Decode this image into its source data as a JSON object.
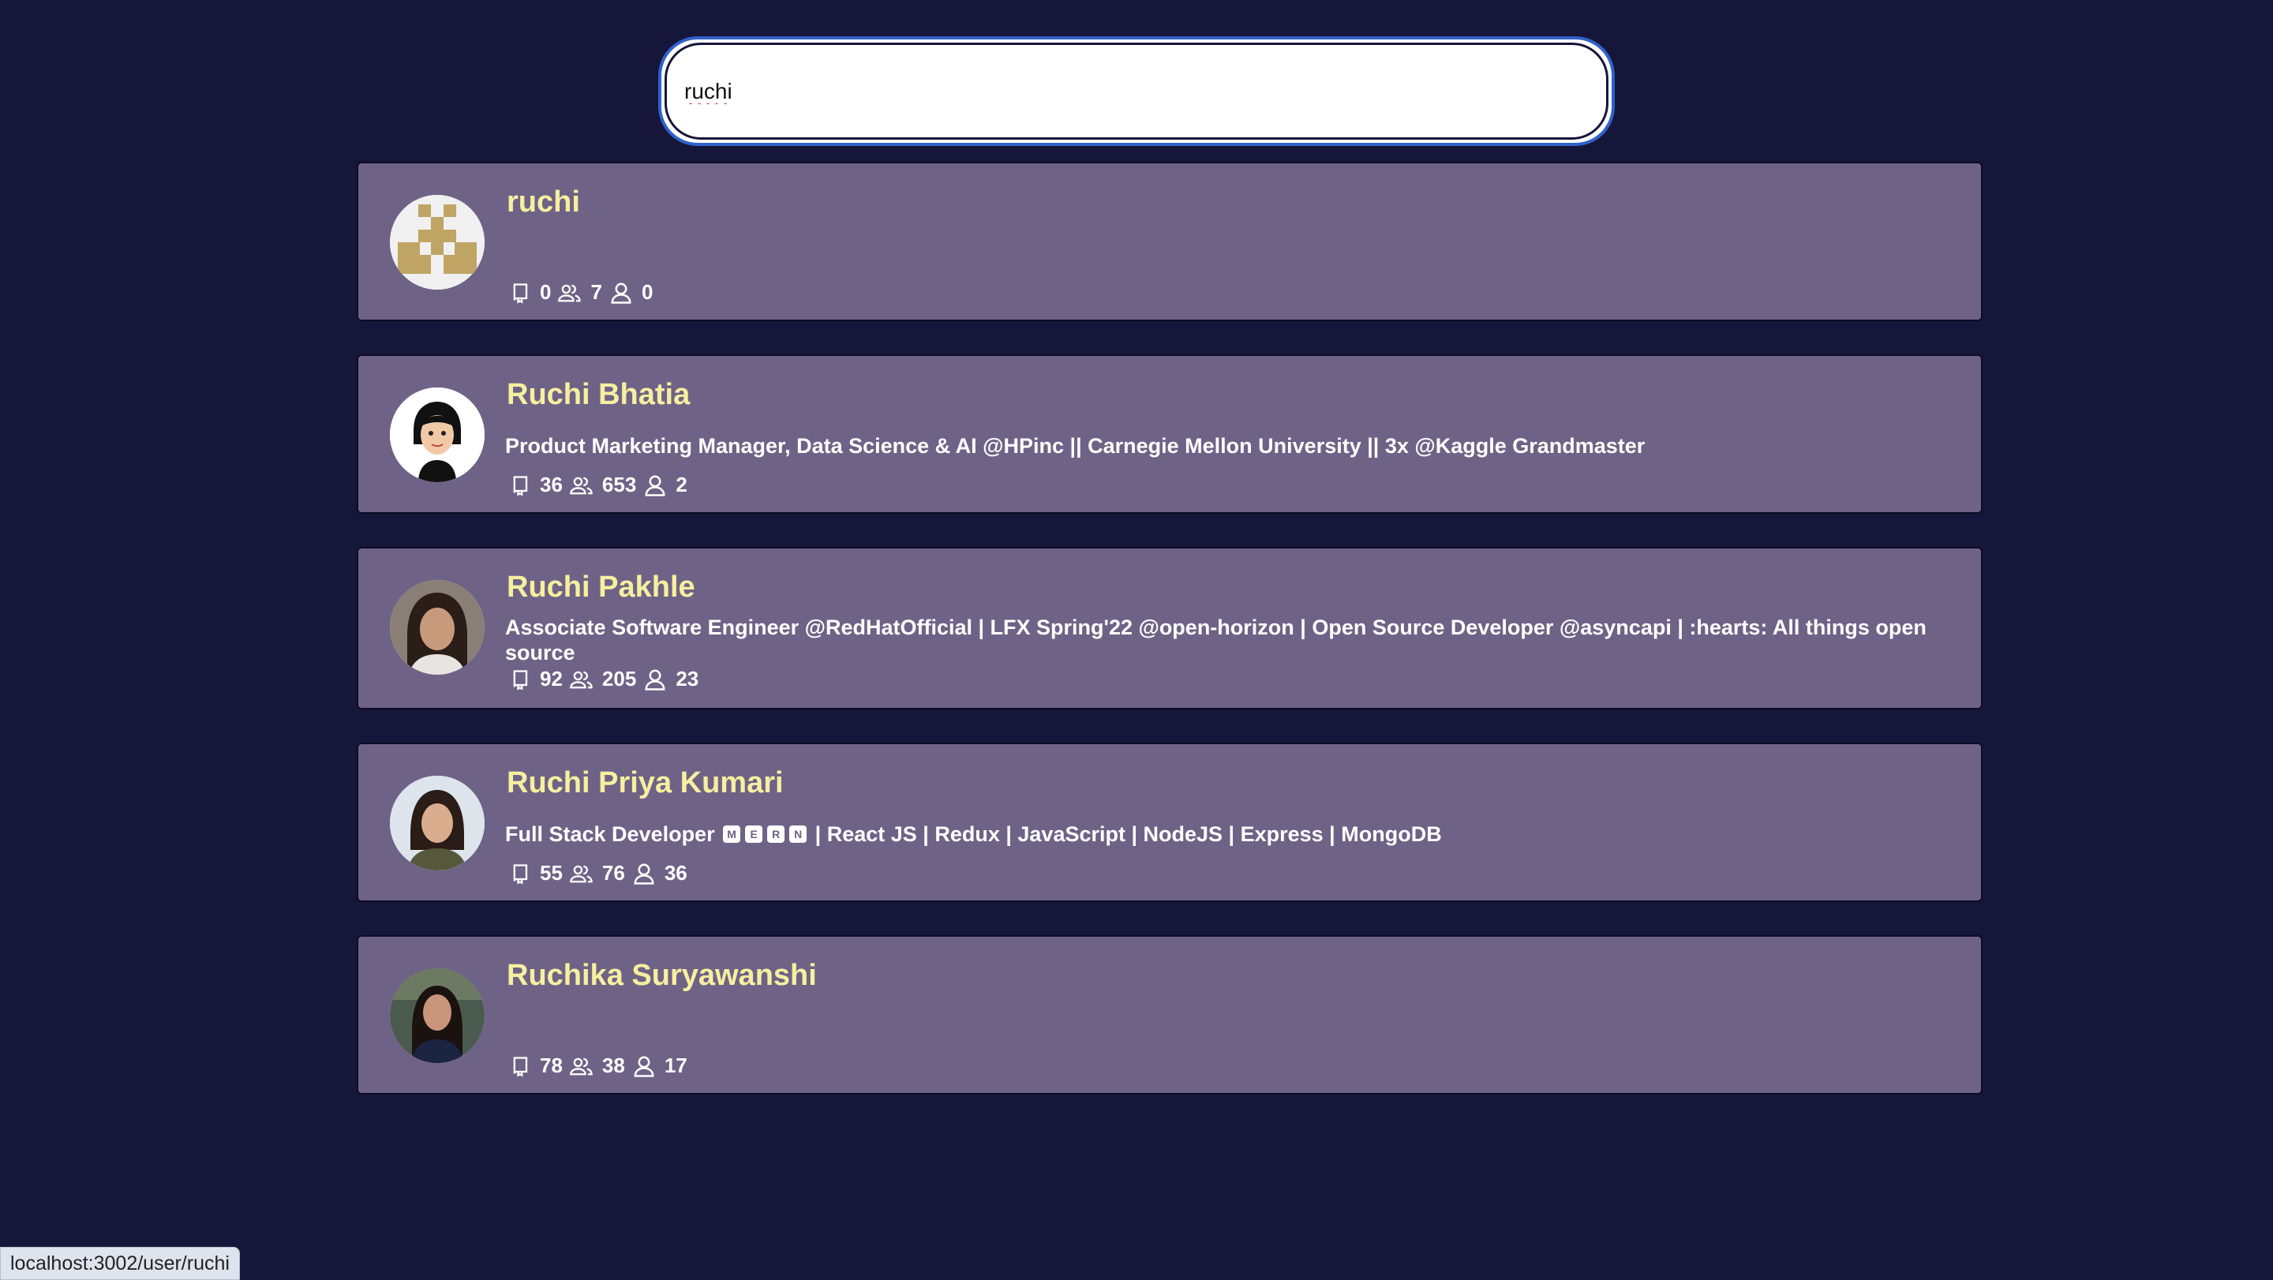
{
  "search": {
    "value": "ruchi"
  },
  "results": [
    {
      "name": "ruchi",
      "bio": "",
      "repos": "0",
      "followers": "7",
      "following": "0"
    },
    {
      "name": "Ruchi Bhatia",
      "bio": "Product Marketing Manager, Data Science & AI @HPinc || Carnegie Mellon University || 3x @Kaggle Grandmaster",
      "repos": "36",
      "followers": "653",
      "following": "2"
    },
    {
      "name": "Ruchi Pakhle",
      "bio": "Associate Software Engineer @RedHatOfficial | LFX Spring'22 @open-horizon | Open Source Developer @asyncapi | :hearts: All things open source",
      "repos": "92",
      "followers": "205",
      "following": "23"
    },
    {
      "name": "Ruchi Priya Kumari",
      "bio_prefix": "Full Stack Developer",
      "bio_badges": [
        "M",
        "E",
        "R",
        "N"
      ],
      "bio_suffix": "| React JS | Redux | JavaScript | NodeJS | Express | MongoDB",
      "repos": "55",
      "followers": "76",
      "following": "36"
    },
    {
      "name": "Ruchika Suryawanshi",
      "bio": "",
      "repos": "78",
      "followers": "38",
      "following": "17"
    }
  ],
  "status_url": "localhost:3002/user/ruchi",
  "colors": {
    "background": "#16153a",
    "card": "#6e6386",
    "name": "#f7efa0",
    "focus": "#2f62c9"
  },
  "icons": {
    "repos": "book-icon",
    "followers": "users-icon",
    "following": "user-icon"
  }
}
